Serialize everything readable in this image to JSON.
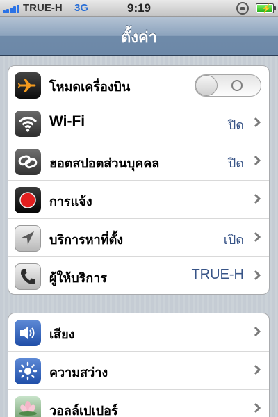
{
  "status_bar": {
    "carrier": "TRUE-H",
    "network": "3G",
    "time": "9:19",
    "icons": [
      "signal-bars-icon",
      "orientation-lock-icon",
      "battery-charging-icon"
    ]
  },
  "nav": {
    "title": "ตั้งค่า"
  },
  "colors": {
    "value_blue": "#385487",
    "nav_blue": "#6d89a9",
    "airplane_orange": "#f39a1e",
    "notification_red": "#e21f1f",
    "sound_blue": "#2d5fb8"
  },
  "group1": [
    {
      "label": "โหมดเครื่องบิน",
      "icon": "airplane-icon",
      "control": "toggle",
      "toggle_on": false
    },
    {
      "label": "Wi-Fi",
      "icon": "wifi-icon",
      "value": "ปิด"
    },
    {
      "label": "ฮอตสปอตส่วนบุคคล",
      "icon": "link-icon",
      "value": "ปิด"
    },
    {
      "label": "การแจ้ง",
      "icon": "notification-icon"
    },
    {
      "label": "บริการหาที่ตั้ง",
      "icon": "location-arrow-icon",
      "value": "เปิด"
    },
    {
      "label": "ผู้ให้บริการ",
      "icon": "phone-icon",
      "value": "TRUE-H"
    }
  ],
  "group2": [
    {
      "label": "เสียง",
      "icon": "speaker-icon"
    },
    {
      "label": "ความสว่าง",
      "icon": "sun-icon"
    },
    {
      "label": "วอลล์เปเปอร์",
      "icon": "flower-icon"
    }
  ]
}
